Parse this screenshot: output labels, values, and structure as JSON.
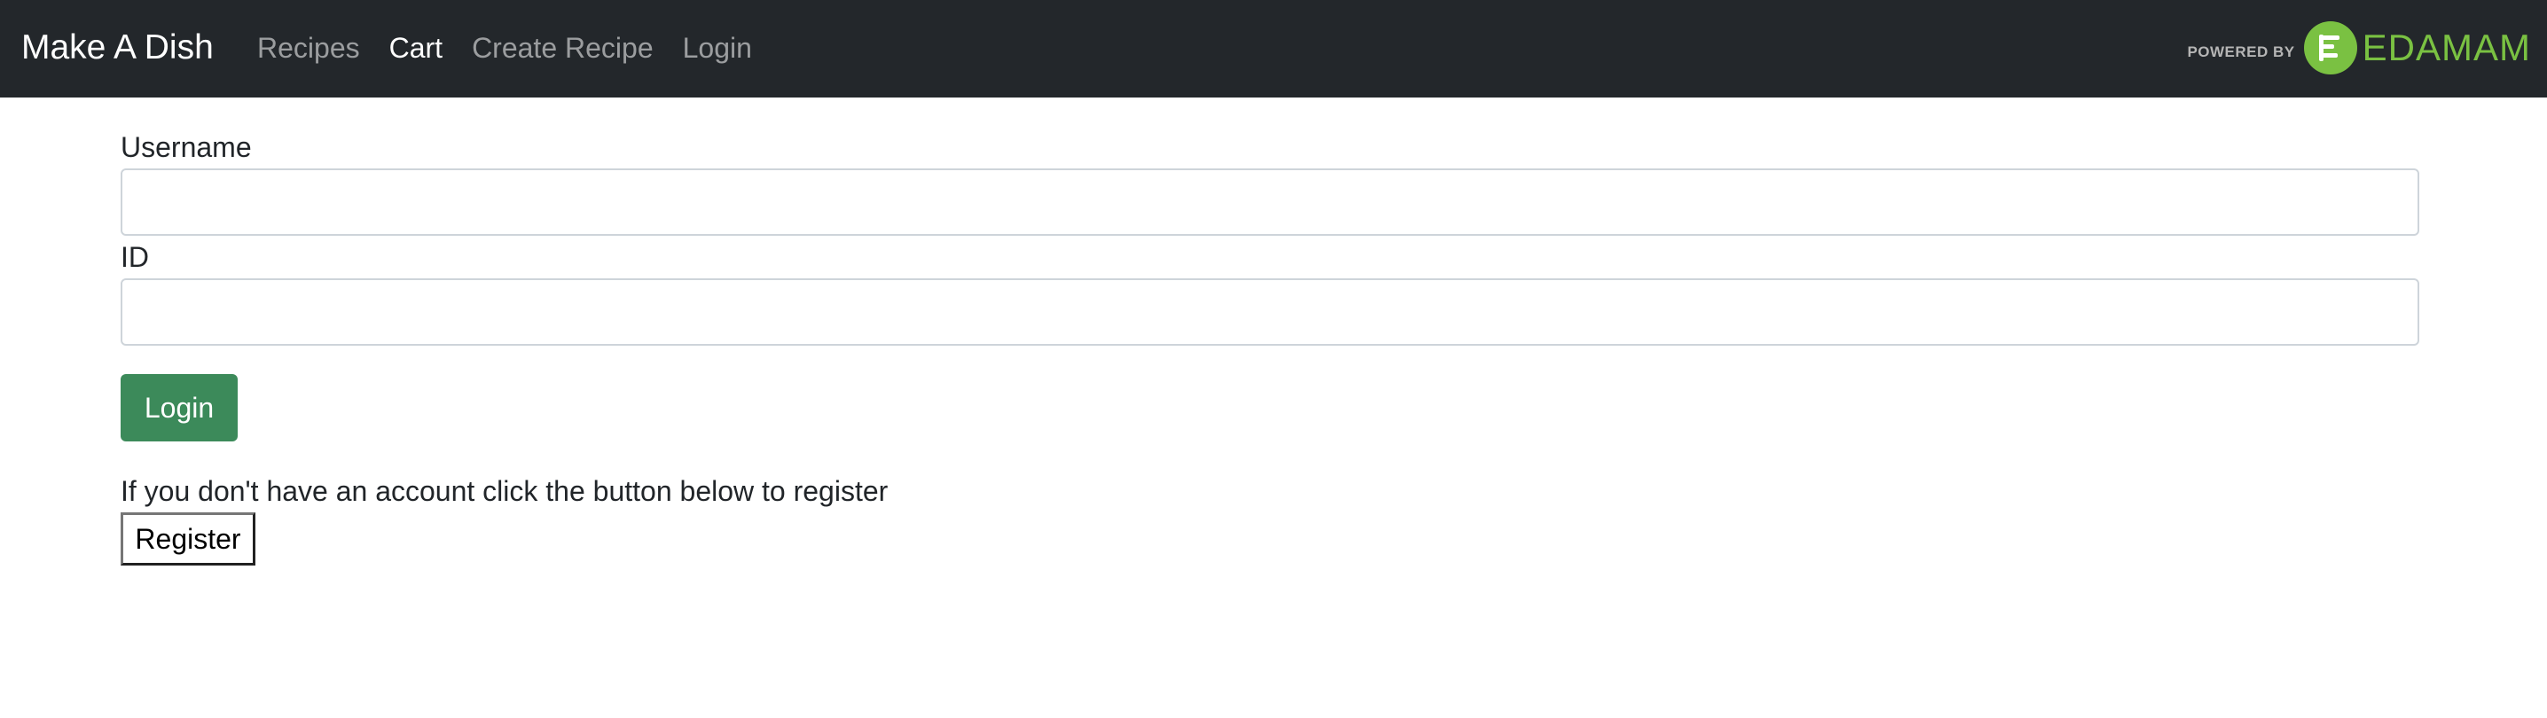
{
  "navbar": {
    "brand": "Make A Dish",
    "links": [
      {
        "label": "Recipes"
      },
      {
        "label": "Cart"
      },
      {
        "label": "Create Recipe"
      },
      {
        "label": "Login"
      }
    ],
    "powered_by": "POWERED BY",
    "powered_logo_text": "EDAMAM"
  },
  "form": {
    "username_label": "Username",
    "username_value": "",
    "id_label": "ID",
    "id_value": "",
    "login_button": "Login",
    "register_note": "If you don't have an account click the button below to register",
    "register_button": "Register"
  },
  "colors": {
    "navbar_bg": "#23272b",
    "login_button_bg": "#3c8a5a",
    "edamam_green": "#7ac142"
  }
}
